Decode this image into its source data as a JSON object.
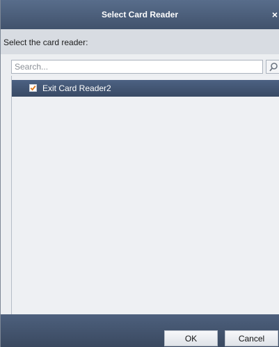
{
  "dialog": {
    "title": "Select Card Reader",
    "close_glyph": "×",
    "prompt": "Select the card reader:"
  },
  "search": {
    "placeholder": "Search...",
    "value": "",
    "icon": "search-icon"
  },
  "list": {
    "items": [
      {
        "label": "Exit Card Reader2",
        "checked": true,
        "selected": true
      }
    ]
  },
  "footer": {
    "ok_label": "OK",
    "cancel_label": "Cancel"
  },
  "colors": {
    "title_bar": "#4a5c78",
    "selected_row": "#42557a",
    "checkbox_check": "#e07a1f",
    "panel_bg": "#eceef1"
  }
}
